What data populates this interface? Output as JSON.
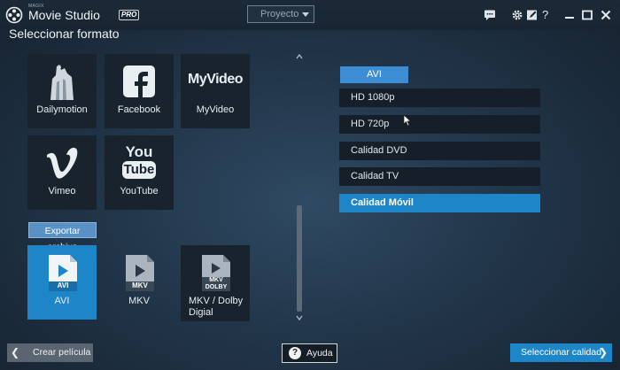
{
  "window": {
    "brand_small": "MAGIX",
    "brand": "Movie Studio",
    "edition": "PRO",
    "project_dropdown": "Proyecto",
    "toolbar_icons": [
      "chat-icon",
      "gear-icon",
      "edit-icon",
      "help-icon",
      "minimize-icon",
      "maximize-icon",
      "close-icon"
    ],
    "help_glyph": "?"
  },
  "heading": "Seleccionar formato",
  "platforms": [
    {
      "label": "Dailymotion",
      "icon": "dailymotion-icon"
    },
    {
      "label": "Facebook",
      "icon": "facebook-icon"
    },
    {
      "label": "MyVideo",
      "icon": "myvideo-icon",
      "logo_text": "MyVideo"
    },
    {
      "label": "Vimeo",
      "icon": "vimeo-icon"
    },
    {
      "label": "YouTube",
      "icon": "youtube-icon",
      "logo_you": "You",
      "logo_tube": "Tube"
    }
  ],
  "export_section_label": "Exportar archivo",
  "file_formats": [
    {
      "label": "AVI",
      "badge": "AVI",
      "selected": true
    },
    {
      "label": "MKV",
      "badge": "MKV",
      "selected": false
    },
    {
      "label": "MKV / Dolby Digial",
      "badge_line1": "MKV",
      "badge_line2": "DOLBY",
      "selected": false
    }
  ],
  "quality": {
    "format_tab": "AVI",
    "options": [
      {
        "label": "HD 1080p",
        "selected": false
      },
      {
        "label": "HD 720p",
        "selected": false
      },
      {
        "label": "Calidad DVD",
        "selected": false
      },
      {
        "label": "Calidad TV",
        "selected": false
      },
      {
        "label": "Calidad Móvil",
        "selected": true
      }
    ]
  },
  "footer": {
    "back_label": "Crear película",
    "help_label": "Ayuda",
    "next_label": "Seleccionar calidad"
  },
  "colors": {
    "accent": "#1d86c8",
    "tab": "#3d8dd4",
    "tile_bg": "#18232e",
    "back_button": "#5b6571"
  }
}
